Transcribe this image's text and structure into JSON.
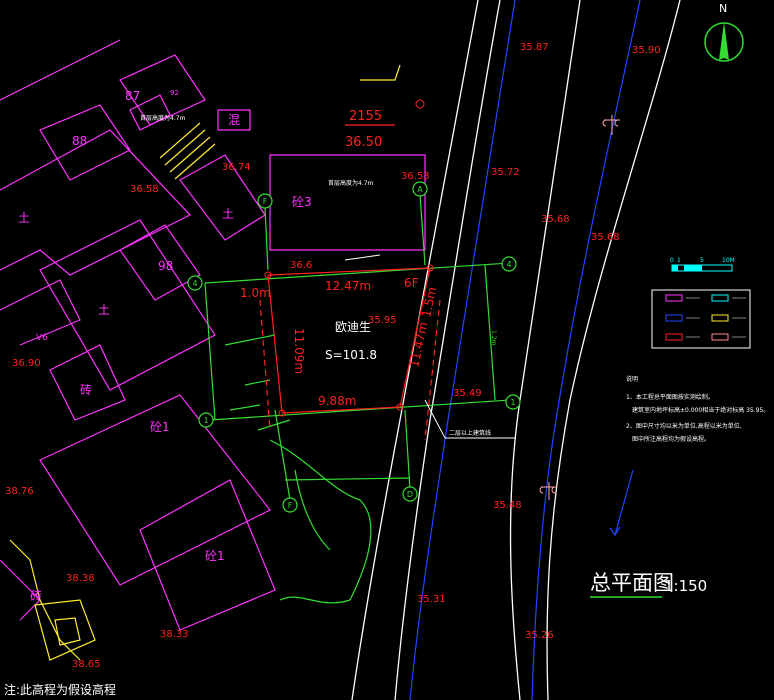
{
  "colors": {
    "background": "#000000",
    "building": "#ff33ff",
    "survey": "#ff2020",
    "road": "#ffffff",
    "river": "#2244ff",
    "boundary": "#33dd33",
    "annotation": "#ffffff",
    "scale_bar": "#00ffff"
  },
  "compass": {
    "north_label": "N"
  },
  "title": {
    "main": "总平面图",
    "scale": "1:150"
  },
  "note_bottom": "注:此高程为假设高程",
  "elevations": {
    "e1": "35.87",
    "e2": "35.90",
    "e3": "35.72",
    "e4": "35.68",
    "e5": "35.68",
    "e6": "36.53",
    "e7": "36.74",
    "e8": "36.58",
    "e9": "36.6",
    "e10": "35.95",
    "e11": "35.49",
    "e12": "35.48",
    "e13": "35.31",
    "e14": "35.26",
    "e15": "36.90",
    "e16": "38.76",
    "e17": "38.38",
    "e18": "38.33",
    "e19": "38.65"
  },
  "fraction": {
    "top": "2155",
    "bottom": "36.50"
  },
  "building_labels": {
    "b1": "砼3",
    "b2": "砼1",
    "b3": "砼1",
    "b4": "土",
    "b5": "土",
    "b6": "土",
    "b7": "砖",
    "b8": "砖",
    "b9": "混",
    "b10": "88",
    "b11": "98",
    "b12": "87",
    "b13": "92",
    "b14": "V6"
  },
  "dimensions": {
    "d1": "12.47m",
    "d2": "1.0m",
    "d3": "11.09m",
    "d4": "11.47m",
    "d5": "1.5m",
    "d6": "9.88m",
    "d7": "6F",
    "d8": "1.2m"
  },
  "site": {
    "owner": "欧迪生",
    "area": "S=101.8"
  },
  "axes": {
    "a_top": "A",
    "a_right": "4",
    "a_left": "4",
    "f_top": "F",
    "f_bottom": "F",
    "d_bottom": "D",
    "one_left": "1",
    "one_right": "1"
  },
  "small_notes": {
    "n1": "首层高度为4.7m",
    "n2": "首层高度为4.7m",
    "n3": "二层以上建筑线"
  },
  "scale_bar": {
    "t0": "0",
    "t1": "1",
    "t2": "5",
    "t3": "10M"
  },
  "legend_notes": {
    "header": "说明",
    "line1": "1、本工程总平面图按实测绘制。",
    "line2": "建筑室内地坪标高±0.000相当于绝对标高 35.95。",
    "line3": "2、图中尺寸均以米为单位,高程以米为单位,",
    "line4": "图中所注高程均为假设高程。"
  }
}
